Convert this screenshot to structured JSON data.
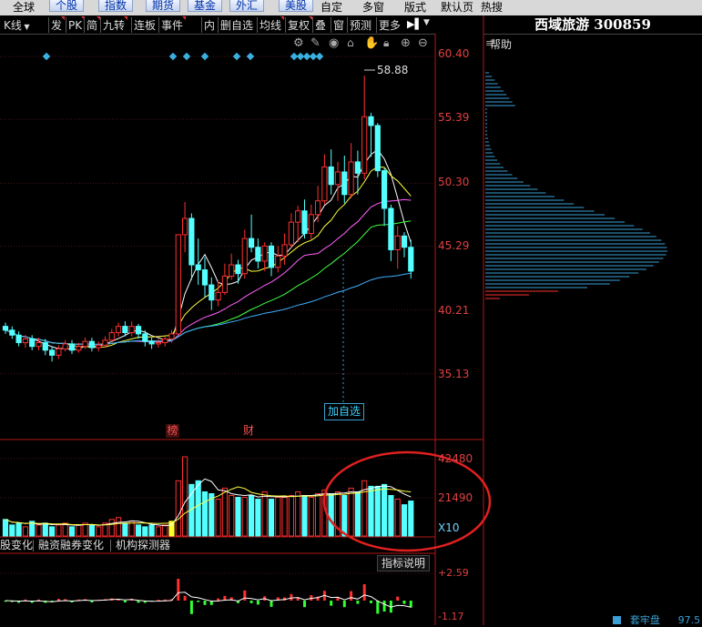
{
  "menu": {
    "items": [
      "全球",
      "个股",
      "指数",
      "期货",
      "基金",
      "外汇",
      "美股",
      "自定",
      "多窗",
      "版式",
      "默认页",
      "热搜"
    ]
  },
  "toolbar": {
    "items": [
      "K线",
      "发",
      "PK",
      "简",
      "九转",
      "连板",
      "事件",
      "内",
      "删自选",
      "均线",
      "复权",
      "叠",
      "窗",
      "预测",
      "更多"
    ]
  },
  "stock": {
    "title": "西域旅游 300859"
  },
  "help_label": "帮助",
  "price_axis": {
    "labels": [
      "60.40",
      "55.39",
      "50.30",
      "45.29",
      "40.21",
      "35.13"
    ]
  },
  "max_marker": "58.88",
  "add_favorite_label": "加自选",
  "event_tags": [
    "榜",
    "财"
  ],
  "volume_axis": {
    "labels": [
      "42480",
      "21490",
      "X10"
    ]
  },
  "sub_tabs": [
    "股变化",
    "融资融券变化",
    "机构探测器"
  ],
  "indicator_button": "指标说明",
  "indicator_axis": {
    "labels": [
      "+2.59",
      "-1.17"
    ]
  },
  "bottom_legend": {
    "label": "套牢盘",
    "value": "97.5"
  },
  "colors": {
    "up": "#ff3030",
    "down": "#54ffff",
    "ma5": "#ffffff",
    "ma10": "#ffff40",
    "ma20": "#ff60ff",
    "ma30": "#40ff40",
    "ma60": "#40b0ff",
    "circle": "#e02020"
  },
  "chart_data": {
    "type": "candlestick",
    "y_range": [
      33.0,
      62.0
    ],
    "candles": [
      [
        38.9,
        38.6,
        39.2,
        38.3
      ],
      [
        38.6,
        38.2,
        38.9,
        37.9
      ],
      [
        38.2,
        37.6,
        38.5,
        37.3
      ],
      [
        37.6,
        37.9,
        38.2,
        37.2
      ],
      [
        37.9,
        37.3,
        38.2,
        37.0
      ],
      [
        37.3,
        37.6,
        38.0,
        37.0
      ],
      [
        37.6,
        37.0,
        37.9,
        36.6
      ],
      [
        37.0,
        36.6,
        37.3,
        36.1
      ],
      [
        36.6,
        37.1,
        37.4,
        36.3
      ],
      [
        37.1,
        37.5,
        37.8,
        36.9
      ],
      [
        37.5,
        37.0,
        37.8,
        36.7
      ],
      [
        37.0,
        37.3,
        37.6,
        36.8
      ],
      [
        37.3,
        37.7,
        38.0,
        37.1
      ],
      [
        37.7,
        37.2,
        38.0,
        36.9
      ],
      [
        37.2,
        37.4,
        37.7,
        36.9
      ],
      [
        37.4,
        37.8,
        38.1,
        37.2
      ],
      [
        37.8,
        38.4,
        38.7,
        37.6
      ],
      [
        38.4,
        38.9,
        39.2,
        38.1
      ],
      [
        38.9,
        38.4,
        39.3,
        38.1
      ],
      [
        38.4,
        38.9,
        39.3,
        38.1
      ],
      [
        38.9,
        38.3,
        39.1,
        37.9
      ],
      [
        38.3,
        37.7,
        38.6,
        37.3
      ],
      [
        37.7,
        37.5,
        38.0,
        37.1
      ],
      [
        37.5,
        37.6,
        37.9,
        37.2
      ],
      [
        37.6,
        37.9,
        38.1,
        37.3
      ],
      [
        37.9,
        38.3,
        38.6,
        37.6
      ],
      [
        38.3,
        46.2,
        46.2,
        38.3
      ],
      [
        46.2,
        47.5,
        48.8,
        44.8
      ],
      [
        47.5,
        43.8,
        47.9,
        42.6
      ],
      [
        43.8,
        43.4,
        45.9,
        42.2
      ],
      [
        43.4,
        42.2,
        44.4,
        41.2
      ],
      [
        42.2,
        41.0,
        42.8,
        40.2
      ],
      [
        41.0,
        41.6,
        42.5,
        40.5
      ],
      [
        41.6,
        42.9,
        43.9,
        41.4
      ],
      [
        42.9,
        43.8,
        44.7,
        42.6
      ],
      [
        43.8,
        43.1,
        44.2,
        42.3
      ],
      [
        43.1,
        45.9,
        46.6,
        42.7
      ],
      [
        45.9,
        45.2,
        47.8,
        44.8
      ],
      [
        45.2,
        44.1,
        45.9,
        43.5
      ],
      [
        44.1,
        45.3,
        45.6,
        43.3
      ],
      [
        45.3,
        43.6,
        45.6,
        42.9
      ],
      [
        43.6,
        44.5,
        45.3,
        43.2
      ],
      [
        44.5,
        45.4,
        46.3,
        43.8
      ],
      [
        45.4,
        47.2,
        47.9,
        45.1
      ],
      [
        47.2,
        48.1,
        48.5,
        45.6
      ],
      [
        48.1,
        46.3,
        49.0,
        45.9
      ],
      [
        46.3,
        47.8,
        48.6,
        45.8
      ],
      [
        47.8,
        48.9,
        50.1,
        47.2
      ],
      [
        48.9,
        51.6,
        52.6,
        48.6
      ],
      [
        51.6,
        50.2,
        53.0,
        49.4
      ],
      [
        50.2,
        51.2,
        52.0,
        48.9
      ],
      [
        51.2,
        49.4,
        52.5,
        48.7
      ],
      [
        49.4,
        52.0,
        53.5,
        49.1
      ],
      [
        52.0,
        51.1,
        52.9,
        49.4
      ],
      [
        51.1,
        55.6,
        58.88,
        50.6
      ],
      [
        55.6,
        54.9,
        55.9,
        52.4
      ],
      [
        54.9,
        51.3,
        55.1,
        50.8
      ],
      [
        51.3,
        48.3,
        51.5,
        46.9
      ],
      [
        48.3,
        45.0,
        48.6,
        44.1
      ],
      [
        45.0,
        46.1,
        46.9,
        43.5
      ],
      [
        46.1,
        45.2,
        46.4,
        44.4
      ],
      [
        45.2,
        43.3,
        45.8,
        42.7
      ]
    ],
    "volume": [
      9,
      6,
      7,
      5,
      8,
      6,
      7,
      5,
      6,
      7,
      5,
      6,
      7,
      6,
      5,
      7,
      9,
      10,
      7,
      8,
      6,
      5,
      6,
      5,
      6,
      8,
      30,
      43,
      28,
      30,
      24,
      23,
      20,
      26,
      22,
      21,
      21,
      22,
      20,
      24,
      20,
      21,
      21,
      22,
      24,
      22,
      21,
      23,
      25,
      23,
      24,
      22,
      26,
      24,
      30,
      27,
      27,
      28,
      22,
      20,
      17,
      19
    ]
  }
}
